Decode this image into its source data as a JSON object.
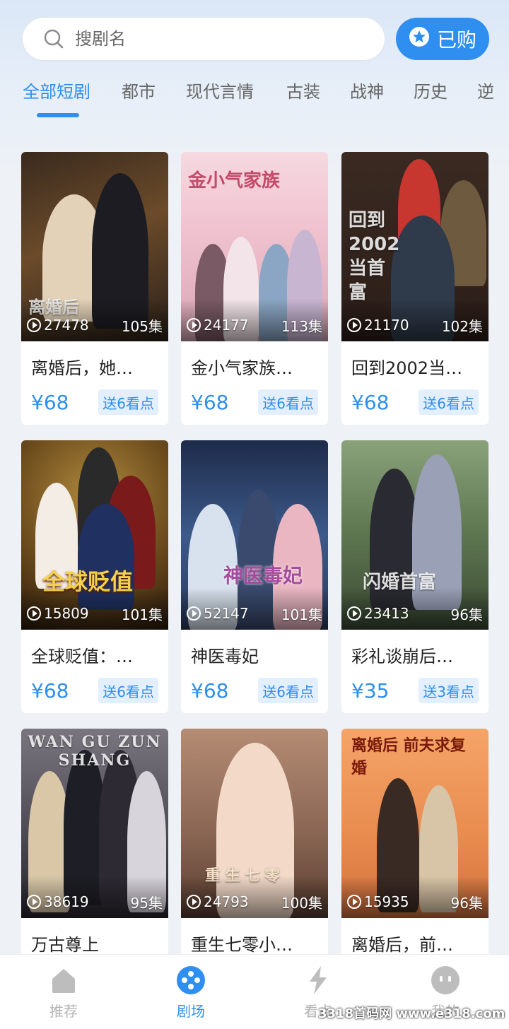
{
  "search": {
    "placeholder": "搜剧名"
  },
  "bought_button": {
    "label": "已购"
  },
  "tabs": [
    "全部短剧",
    "都市",
    "现代言情",
    "古装",
    "战神",
    "历史",
    "逆"
  ],
  "cards": [
    {
      "title": "离婚后，她…",
      "views": "27478",
      "episodes": "105集",
      "price": "¥68",
      "gift": "送6看点",
      "poster_text": "离婚后"
    },
    {
      "title": "金小气家族…",
      "views": "24177",
      "episodes": "113集",
      "price": "¥68",
      "gift": "送6看点",
      "poster_text": "金小气家族"
    },
    {
      "title": "回到2002当…",
      "views": "21170",
      "episodes": "102集",
      "price": "¥68",
      "gift": "送6看点",
      "poster_text": "回到2002当首富"
    },
    {
      "title": "全球贬值：…",
      "views": "15809",
      "episodes": "101集",
      "price": "¥68",
      "gift": "送6看点",
      "poster_text": "全球贬值"
    },
    {
      "title": "神医毒妃",
      "views": "52147",
      "episodes": "101集",
      "price": "¥68",
      "gift": "送6看点",
      "poster_text": "神医毒妃"
    },
    {
      "title": "彩礼谈崩后…",
      "views": "23413",
      "episodes": "96集",
      "price": "¥35",
      "gift": "送3看点",
      "poster_text": "闪婚首富"
    },
    {
      "title": "万古尊上",
      "views": "38619",
      "episodes": "95集",
      "price": "",
      "gift": "",
      "poster_text": "WAN GU ZUN SHANG"
    },
    {
      "title": "重生七零小…",
      "views": "24793",
      "episodes": "100集",
      "price": "",
      "gift": "",
      "poster_text": "重生七零"
    },
    {
      "title": "离婚后，前…",
      "views": "15935",
      "episodes": "96集",
      "price": "",
      "gift": "",
      "poster_text": "离婚后 前夫求复婚"
    }
  ],
  "nav": [
    {
      "label": "推荐",
      "icon": "home-icon"
    },
    {
      "label": "剧场",
      "icon": "theater-icon"
    },
    {
      "label": "看点",
      "icon": "lightning-icon"
    },
    {
      "label": "我的",
      "icon": "profile-icon"
    }
  ],
  "watermark": "3318首码网 www.e318.com",
  "colors": {
    "accent": "#2e8ff0",
    "tag_bg": "#e3effc",
    "page_bg": "#eef1f6"
  }
}
